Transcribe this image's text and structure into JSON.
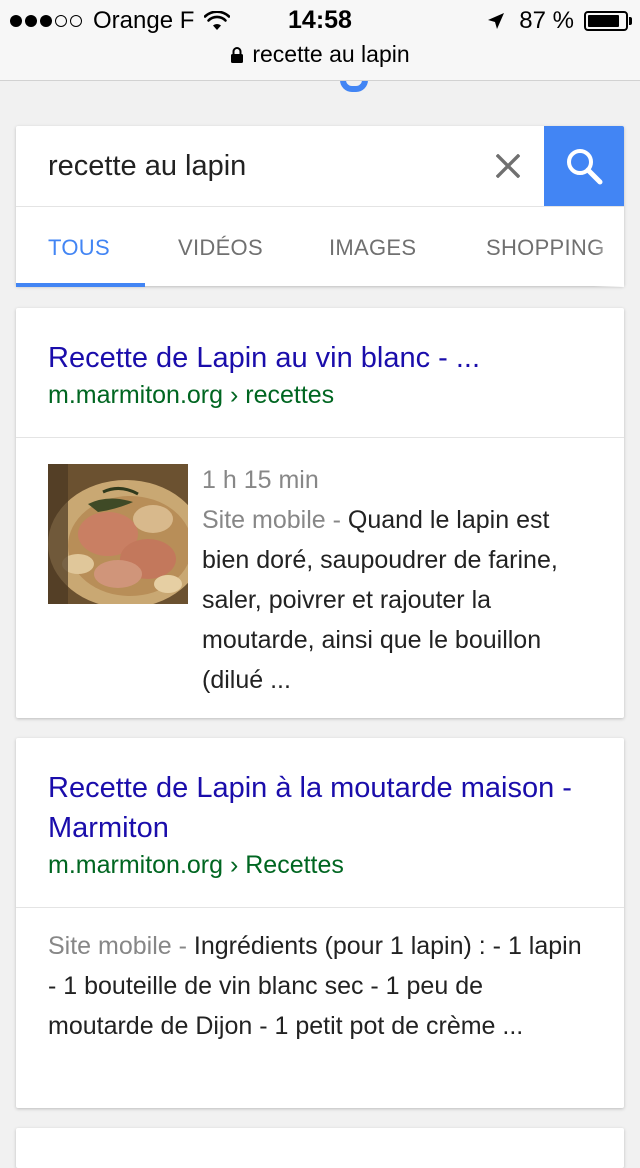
{
  "status_bar": {
    "carrier": "Orange F",
    "time": "14:58",
    "battery_percent": "87 %",
    "battery_level": 0.87,
    "signal_bars_filled": 3,
    "signal_bars_total": 5,
    "url": "recette au lapin"
  },
  "search": {
    "query": "recette au lapin",
    "accent_color": "#4285f4"
  },
  "tabs": [
    {
      "label": "TOUS",
      "active": true
    },
    {
      "label": "VIDÉOS",
      "active": false
    },
    {
      "label": "IMAGES",
      "active": false
    },
    {
      "label": "SHOPPING",
      "active": false
    }
  ],
  "results": [
    {
      "title": "Recette de Lapin au vin blanc - ...",
      "url": "m.marmiton.org › recettes",
      "duration": "1 h 15 min",
      "site_label": "Site mobile - ",
      "snippet": "Quand le lapin est bien doré, saupoudrer de farine, saler, poivrer et rajouter la moutarde, ainsi que le bouillon (dilué ..."
    },
    {
      "title": "Recette de Lapin à la moutarde maison - Marmiton",
      "url": "m.marmiton.org › Recettes",
      "site_label": "Site mobile - ",
      "snippet": "Ingrédients (pour 1 lapin) : - 1 lapin - 1 bouteille de vin blanc sec - 1 peu de moutarde de Dijon - 1 petit pot de crème ..."
    }
  ],
  "colors": {
    "link_title": "#1a0dab",
    "link_url": "#006621",
    "muted": "#878787"
  }
}
